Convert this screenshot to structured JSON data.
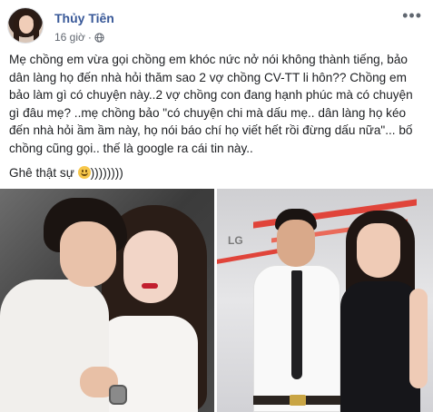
{
  "post": {
    "author_name": "Thủy Tiên",
    "timestamp": "16 giờ",
    "privacy_icon": "globe-icon",
    "more_icon": "more-options-icon",
    "more_label": "•••",
    "paragraph_1": "Mẹ chồng em vừa gọi chồng em khóc nức nở nói không thành tiếng, bảo dân làng họ đến nhà hỏi thăm sao 2 vợ chồng CV-TT li hôn?? Chồng em bảo làm gì có chuyện này..2 vợ chồng con đang hạnh phúc mà có chuyện gì đâu mẹ? ..mẹ chồng bảo \"có chuyện chi mà dấu mẹ.. dân làng họ kéo đến nhà hỏi ầm ầm này, họ nói báo chí họ viết hết rồi đừng dấu nữa\"... bố chồng cũng gọi.. thế là google ra cái tin này..",
    "paragraph_2_text": "Ghê thật sự ",
    "paragraph_2_emoji": "smiling-emoji",
    "paragraph_2_suffix": "))))))))"
  },
  "photos": [
    {
      "name": "photo-couple-studio"
    },
    {
      "name": "photo-couple-event",
      "background_logo": "LG"
    }
  ],
  "colors": {
    "author_link": "#385898",
    "meta_text": "#616770",
    "body_text": "#1c1e21"
  }
}
